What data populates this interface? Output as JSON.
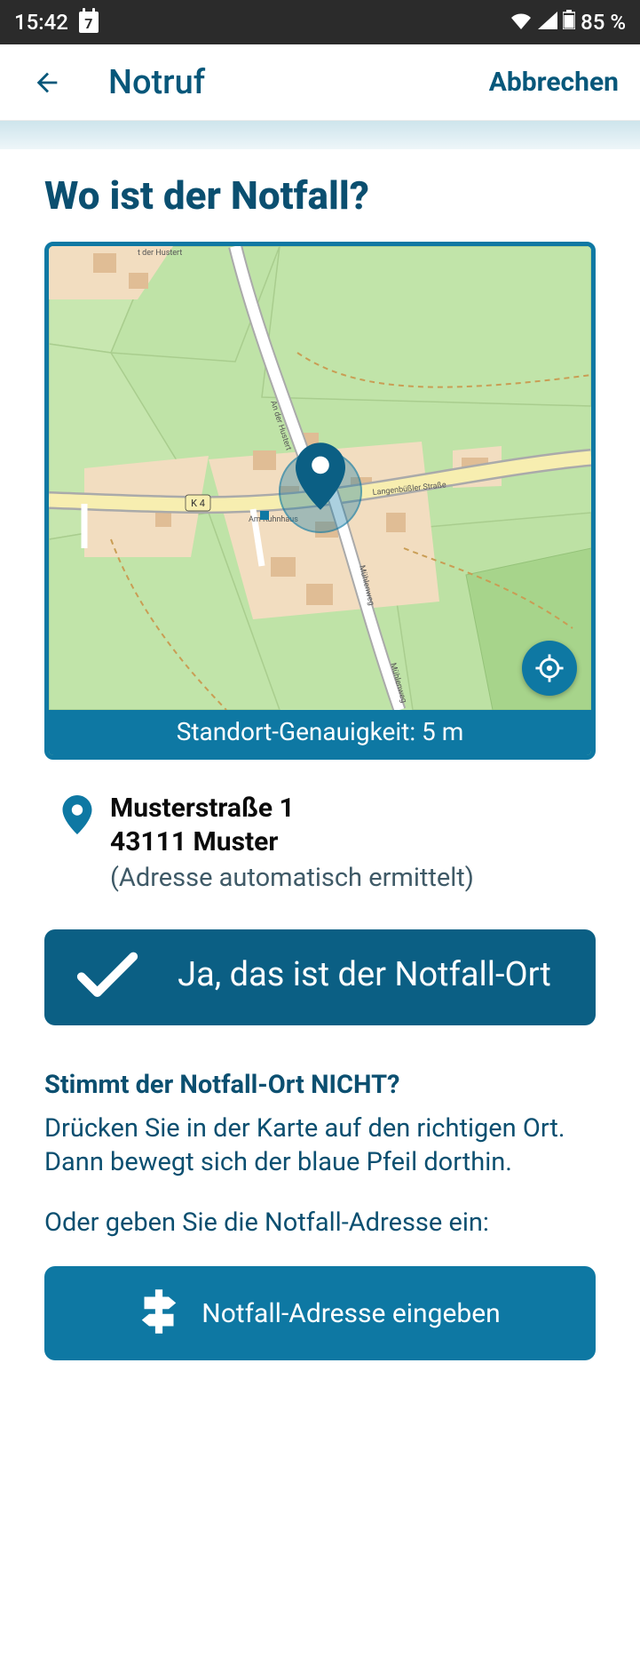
{
  "status": {
    "time": "15:42",
    "calendar_day": "7",
    "battery_text": "85 %"
  },
  "header": {
    "title": "Notruf",
    "cancel_label": "Abbrechen"
  },
  "page": {
    "heading": "Wo ist der Notfall?"
  },
  "map": {
    "accuracy_label": "Standort-Genauigkeit: 5 m",
    "road_labels": {
      "k4": "K 4",
      "langenbusler": "Langenbüßler Straße",
      "muhlenweg": "Mühlenweg",
      "am_kuhhaus": "Am Kuhnhaus",
      "an_der_hustert": "An der Hustert",
      "der_hustert": "t der Hustert"
    }
  },
  "address": {
    "line1": "Musterstraße 1",
    "line2": "43111 Muster",
    "note": "(Adresse automatisch ermittelt)"
  },
  "confirm": {
    "label": "Ja, das ist der Notfall-Ort"
  },
  "help": {
    "heading": "Stimmt der Notfall-Ort NICHT?",
    "line1": "Drücken Sie in der Karte auf den richtigen Ort. Dann bewegt sich der blaue Pfeil dorthin.",
    "line2": "Oder geben Sie die Notfall-Adresse ein:"
  },
  "enter_address": {
    "label": "Notfall-Adresse eingeben"
  }
}
